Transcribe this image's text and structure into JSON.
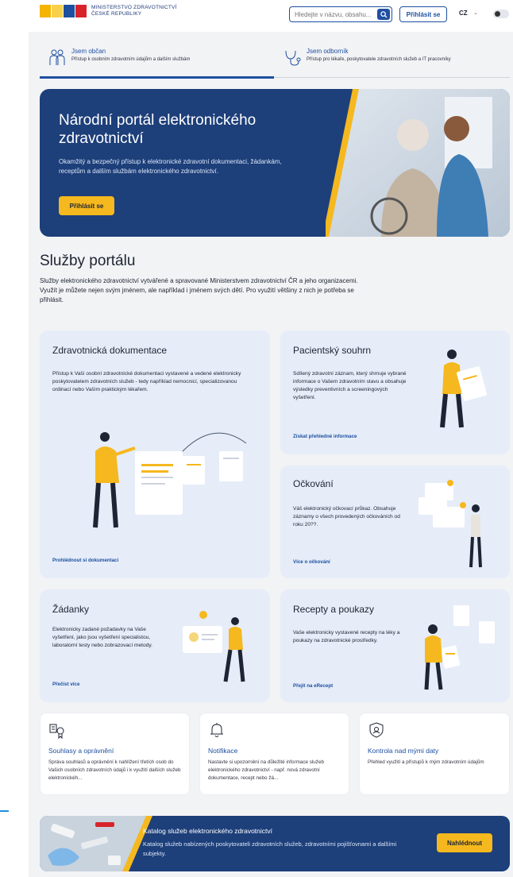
{
  "header": {
    "logo_line1": "MINISTERSTVO ZDRAVOTNICTVÍ",
    "logo_line2": "ČESKÉ REPUBLIKY",
    "search_placeholder": "Hledejte v názvu, obsahu...",
    "login_label": "Přihlásit se",
    "language": "CZ"
  },
  "persona_tabs": [
    {
      "title": "Jsem občan",
      "subtitle": "Přístup k osobním zdravotním údajům a dalším službám",
      "icon": "family-icon",
      "active": true
    },
    {
      "title": "Jsem odborník",
      "subtitle": "Přístup pro lékaře, poskytovatele zdravotních služeb a IT pracovníky",
      "icon": "stethoscope-icon",
      "active": false
    }
  ],
  "hero": {
    "title": "Národní portál elektronického zdravotnictví",
    "description": "Okamžitý a bezpečný přístup k elektronické zdravotní dokumentaci, žádankám, receptům a dalším službám elektronického zdravotnictví.",
    "button_label": "Přihlásit se"
  },
  "services": {
    "title": "Služby portálu",
    "description": "Služby elektronického zdravotnictví vytvářené a spravované Ministerstvem zdravotnictví ČR a jeho organizacemi. Využít je můžete nejen svým jménem, ale například i jménem svých dětí. Pro využití většiny z nich je potřeba se přihlásit.",
    "cards": [
      {
        "title": "Zdravotnická dokumentace",
        "description": "Přístup k Vaší osobní zdravotnické dokumentaci vystavené a vedené elektronicky poskytovatelem zdravotních služeb - tedy například nemocnicí, specializovanou ordinací nebo Vaším praktickým lékařem.",
        "link": "Prohlédnout si dokumentaci"
      },
      {
        "title": "Pacientský souhrn",
        "description": "Sdílený zdravotní záznam, který shrnuje vybrané informace o Vašem zdravotním stavu a obsahuje výsledky preventivních a screeningových vyšetření.",
        "link": "Získat přehledné informace"
      },
      {
        "title": "Očkování",
        "description": "Váš elektronický očkovací průkaz. Obsahuje záznamy o všech provedených očkováních od roku 20??.",
        "link": "Více o očkování"
      },
      {
        "title": "Žádanky",
        "description": "Elektronicky zadané požadavky na Vaše vyšetření, jako jsou vyšetření specialistou, laboratorní testy nebo zobrazovací metody.",
        "link": "Přečíst více"
      },
      {
        "title": "Recepty a poukazy",
        "description": "Vaše elektronicky vystavené recepty na léky a poukazy na zdravotnické prostředky.",
        "link": "Přejít na eRecept"
      }
    ],
    "mini_cards": [
      {
        "title": "Souhlasy a oprávnění",
        "description": "Správa souhlasů a oprávnění k nahlížení třetích osob do Vašich osobních zdravotních údajů i k využití dalších služeb elektronickéh...",
        "icon": "consent-icon"
      },
      {
        "title": "Notifikace",
        "description": "Nastavte si upozornění na důležité informace služeb elektronického zdravotnictví - např. nová zdravotní dokumentace, recept nebo žá...",
        "icon": "bell-icon"
      },
      {
        "title": "Kontrola nad mými daty",
        "description": "Přehled využití a přístupů k mým zdravotním údajům",
        "icon": "shield-icon"
      }
    ]
  },
  "catalog": {
    "title": "Katalog služeb elektronického zdravotnictví",
    "description": "Katalog služeb nabízených poskytovateli zdravotních služeb, zdravotními pojišťovnami a dalšími subjekty.",
    "button_label": "Nahlédnout"
  },
  "colors": {
    "primary": "#1e4fa1",
    "accent": "#f5b81e",
    "card_bg": "#e6edf8",
    "hero_bg": "#1d3f7a"
  }
}
